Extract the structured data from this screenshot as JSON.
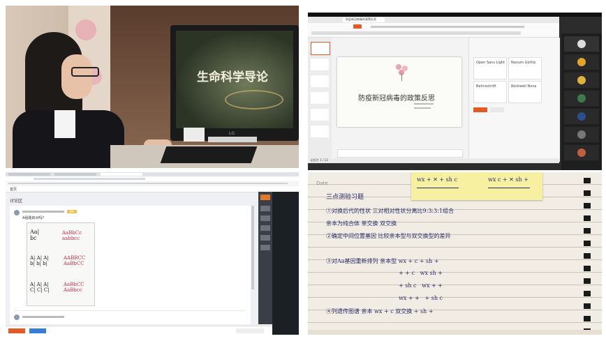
{
  "photo_classroom": {
    "slide_title": "生命科学导论",
    "monitor_brand": "LG"
  },
  "wps_screen": {
    "window_title": "防疫新冠病毒的政策反思",
    "slide_title": "防疫新冠病毒的政策反思",
    "font_options": [
      "Open Sans Light",
      "Nanum Gothic",
      "Bahnschrift",
      "Rockwell Nova"
    ],
    "status_bar": "幻灯片 1 / 13",
    "video_tiles": 7
  },
  "discussion_forum": {
    "nav": "首页",
    "section": "讨论区",
    "post_question": "A组题目对吗?",
    "answer_tag": "答案"
  },
  "notebook": {
    "heading": "Date",
    "section_title": "三点测验习题",
    "lines": [
      "①对换后代的性状 三对相对性状分离比9:3:3:1组合",
      "亲本为纯合体 单交换 双交换",
      "②确定中间位置基因 比较亲本型与双交换型的差异",
      "③对Aa基因重新排列 亲本型 wx + c + sh +",
      "④列遗传图谱 亲本 wx + c  双交换 + sh +"
    ]
  }
}
